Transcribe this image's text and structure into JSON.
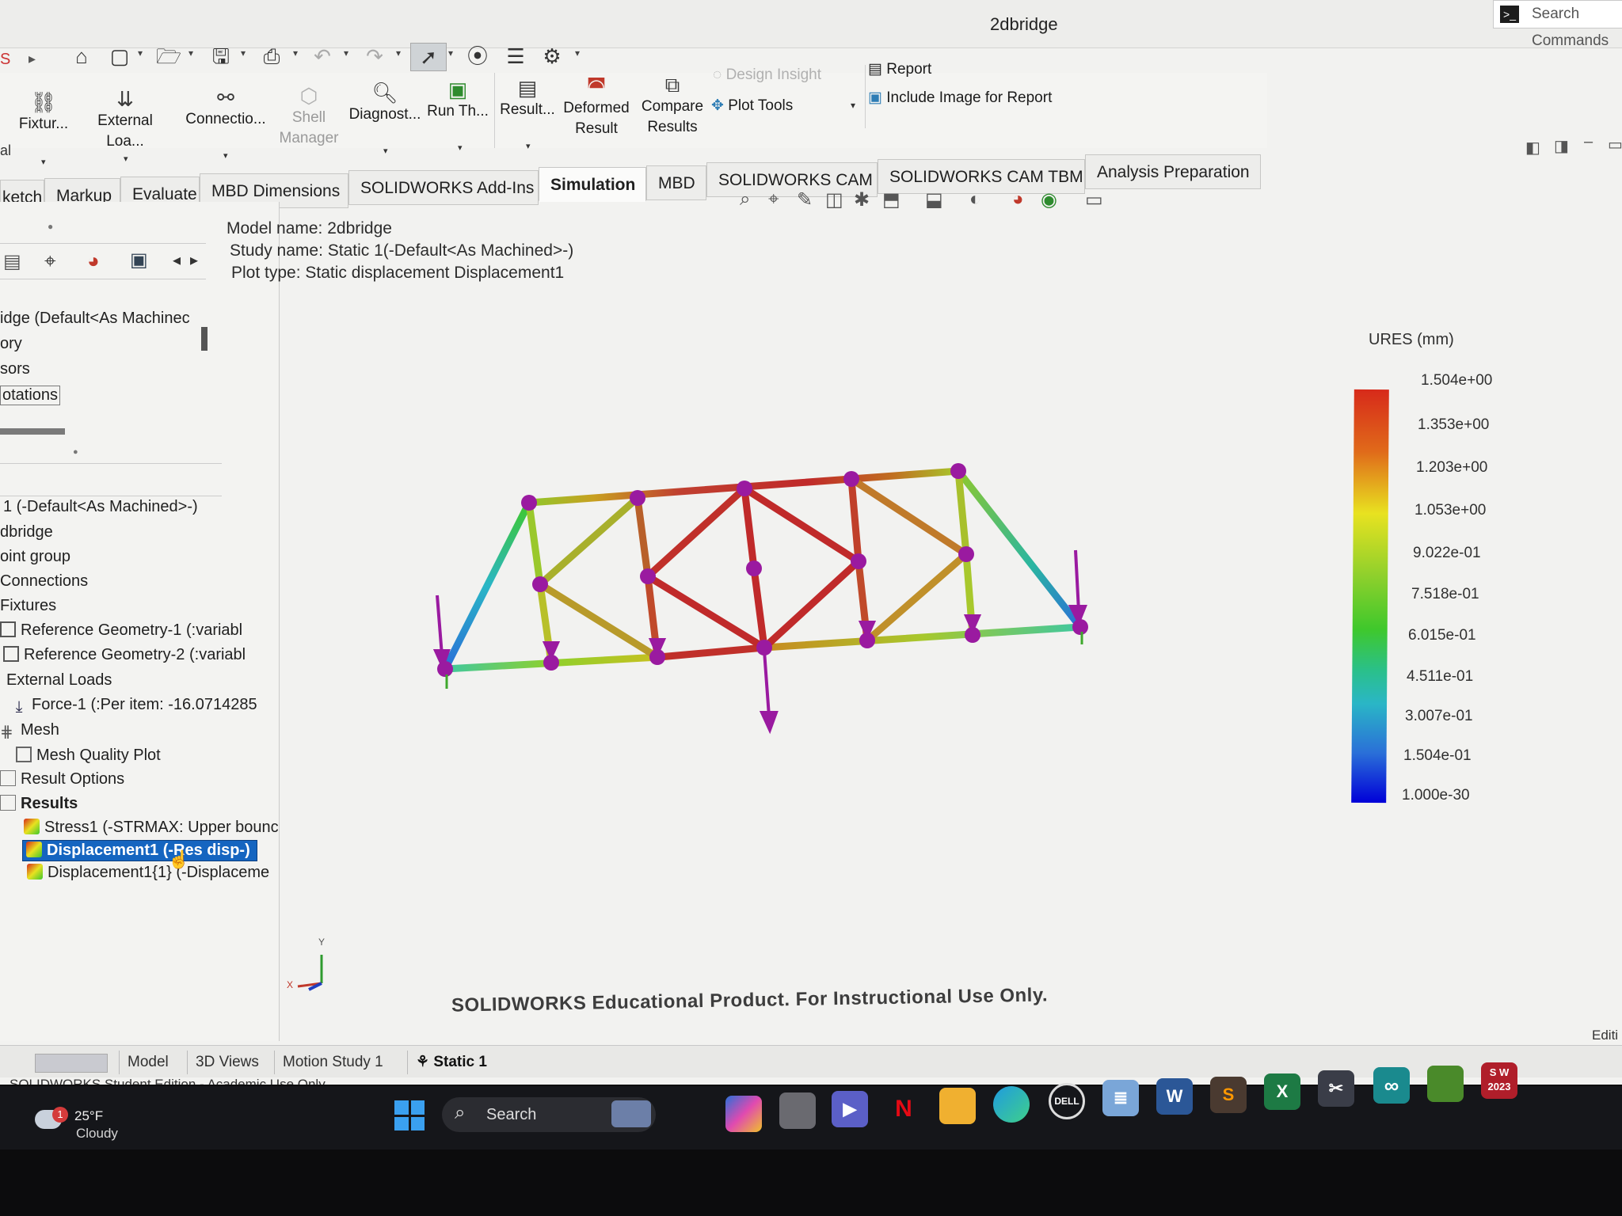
{
  "window": {
    "title": "2dbridge",
    "search_commands": "Search Commands"
  },
  "ribbon": {
    "buttons": [
      "Fixtur...",
      "External Loa...",
      "Connectio...",
      "Shell",
      "Manager",
      "Diagnost...",
      "Run Th...",
      "Result...",
      "Deformed",
      "Result",
      "Compare",
      "Results"
    ],
    "design_insight": "Design Insight",
    "plot_tools": "Plot Tools",
    "report": "Report",
    "include_image": "Include Image for Report",
    "row_fragment": "al"
  },
  "tabs": [
    "ketch",
    "Markup",
    "Evaluate",
    "MBD Dimensions",
    "SOLIDWORKS Add-Ins",
    "Simulation",
    "MBD",
    "SOLIDWORKS CAM",
    "SOLIDWORKS CAM TBM",
    "Analysis Preparation"
  ],
  "active_tab": "Simulation",
  "top_tree": [
    "idge (Default<As Machinec",
    "ory",
    "sors",
    "otations"
  ],
  "tree": [
    "1 (-Default<As Machined>-)",
    "dbridge",
    "oint group",
    "Connections",
    "Fixtures",
    "Reference Geometry-1 (:variabl",
    "Reference Geometry-2 (:variabl",
    "External Loads",
    "Force-1 (:Per item: -16.0714285",
    "Mesh",
    "Mesh Quality Plot",
    "Result Options",
    "Results",
    "Stress1 (-STRMAX: Upper bounc",
    "Displacement1 (-Res disp-)",
    "Displacement1{1} (-Displaceme"
  ],
  "model_info": {
    "model_name": "Model name: 2dbridge",
    "study_name": "Study name: Static 1(-Default<As Machined>-)",
    "plot_type": "Plot type: Static displacement Displacement1"
  },
  "legend": {
    "title": "URES (mm)",
    "values": [
      "1.504e+00",
      "1.353e+00",
      "1.203e+00",
      "1.053e+00",
      "9.022e-01",
      "7.518e-01",
      "6.015e-01",
      "4.511e-01",
      "3.007e-01",
      "1.504e-01",
      "1.000e-30"
    ]
  },
  "axis": {
    "y": "Y",
    "x": "X"
  },
  "watermark": "SOLIDWORKS Educational Product. For Instructional Use Only.",
  "bottom_tabs": [
    "Model",
    "3D Views",
    "Motion Study 1",
    "Static 1"
  ],
  "status": {
    "left": "SOLIDWORKS Student Edition - Academic Use Only",
    "right": "Editi"
  },
  "taskbar": {
    "weather_temp": "25°F",
    "weather_desc": "Cloudy",
    "weather_badge": "1",
    "search": "Search",
    "sw_badge": "S W 2023",
    "icons": [
      "start-icon",
      "widget-icon",
      "copilot-icon",
      "task-view-icon",
      "teams-icon",
      "netflix-icon",
      "file-explorer-icon",
      "edge-icon",
      "dell-icon",
      "notepad-icon",
      "word-icon",
      "sublime-icon",
      "excel-icon",
      "snipping-icon",
      "arduino-icon",
      "game-icon",
      "solidworks-icon"
    ]
  },
  "colors": {
    "legend_top": "#d72a1a",
    "legend_mid": "#e8e220",
    "legend_green": "#3fc82c",
    "legend_cyan": "#2ab6c6",
    "legend_bottom": "#0000d8",
    "node": "#9a1aa0",
    "selection": "#1565c0"
  }
}
